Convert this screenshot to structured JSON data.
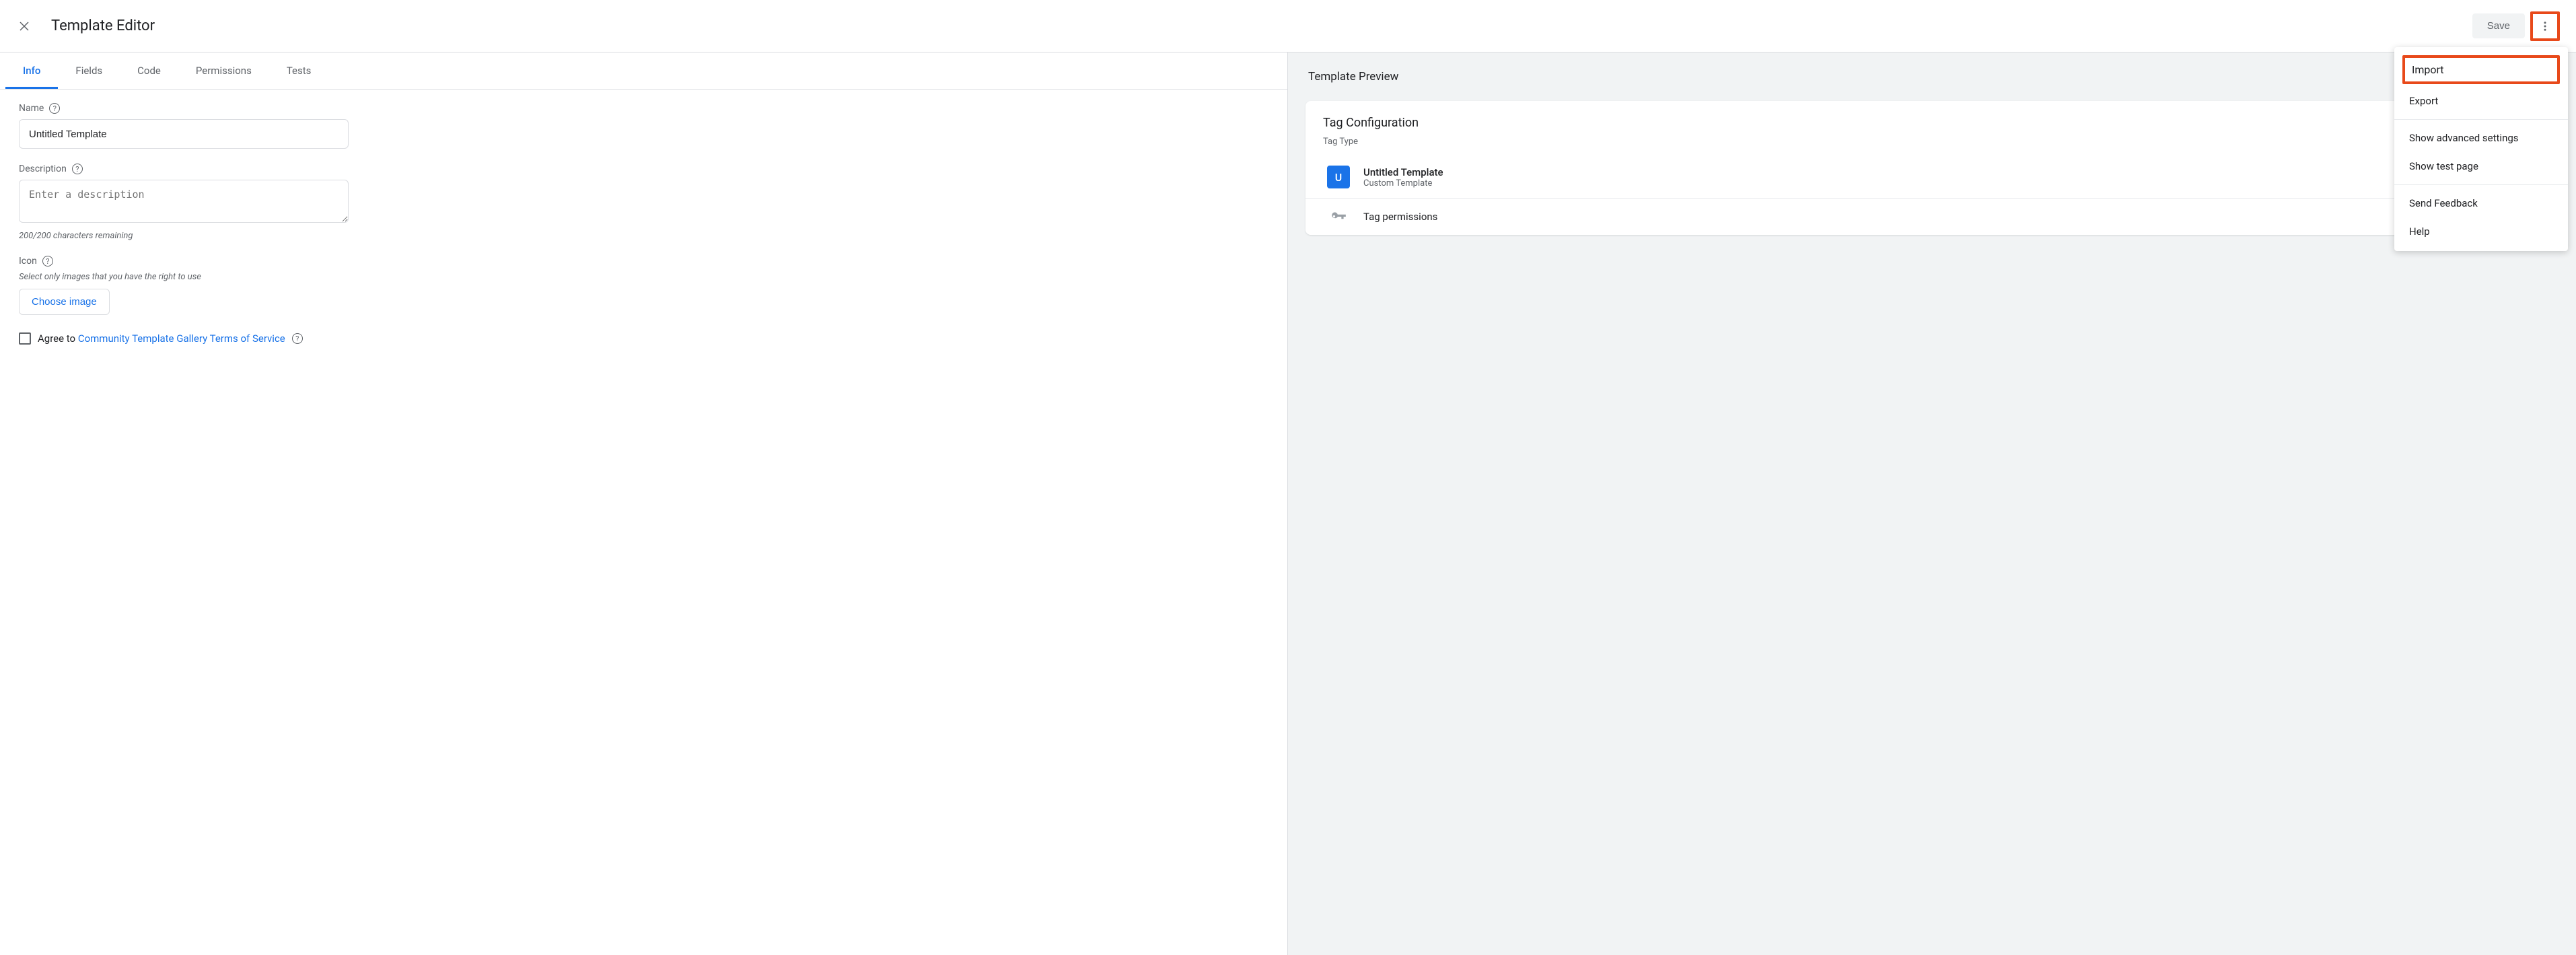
{
  "header": {
    "title": "Template Editor",
    "save_label": "Save"
  },
  "tabs": [
    "Info",
    "Fields",
    "Code",
    "Permissions",
    "Tests"
  ],
  "active_tab_index": 0,
  "form": {
    "name_label": "Name",
    "name_value": "Untitled Template",
    "description_label": "Description",
    "description_placeholder": "Enter a description",
    "description_hint": "200/200 characters remaining",
    "icon_label": "Icon",
    "icon_hint": "Select only images that you have the right to use",
    "choose_image_label": "Choose image",
    "agree_prefix": "Agree to ",
    "agree_link": "Community Template Gallery Terms of Service"
  },
  "preview": {
    "title": "Template Preview",
    "card_title": "Tag Configuration",
    "tag_type_label": "Tag Type",
    "tag_icon_letter": "U",
    "tag_name": "Untitled Template",
    "tag_subtitle": "Custom Template",
    "permissions_row": "Tag permissions"
  },
  "menu": {
    "import": "Import",
    "export": "Export",
    "advanced": "Show advanced settings",
    "test_page": "Show test page",
    "feedback": "Send Feedback",
    "help": "Help"
  }
}
